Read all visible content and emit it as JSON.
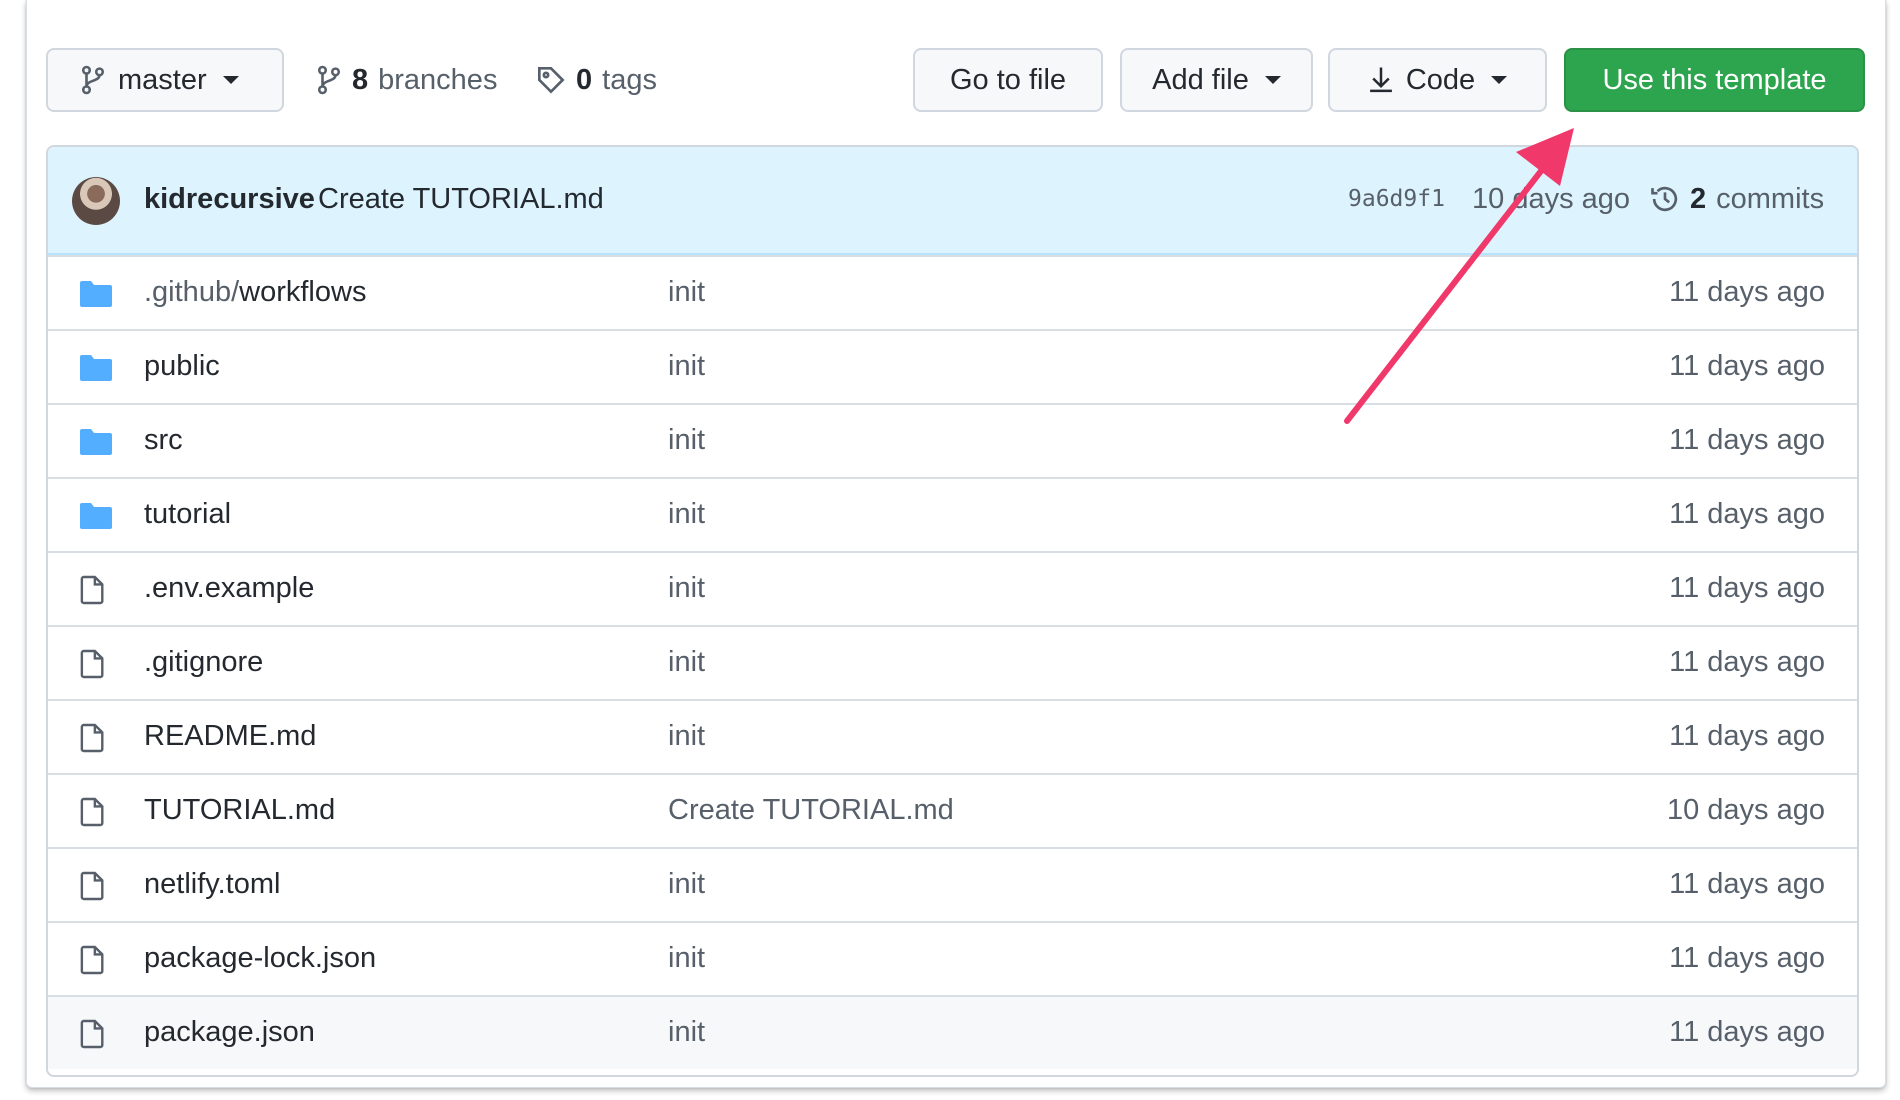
{
  "toolbar": {
    "branch_label": "master",
    "branches_count": "8",
    "branches_label": "branches",
    "tags_count": "0",
    "tags_label": "tags",
    "go_to_file_label": "Go to file",
    "add_file_label": "Add file",
    "code_label": "Code",
    "template_label": "Use this template"
  },
  "commit": {
    "author": "kidrecursive",
    "message": "Create TUTORIAL.md",
    "sha": "9a6d9f1",
    "time": "10 days ago",
    "count": "2",
    "count_label": "commits"
  },
  "files": [
    {
      "type": "folder",
      "prefix": ".github/",
      "name": "workflows",
      "message": "init",
      "time": "11 days ago"
    },
    {
      "type": "folder",
      "prefix": "",
      "name": "public",
      "message": "init",
      "time": "11 days ago"
    },
    {
      "type": "folder",
      "prefix": "",
      "name": "src",
      "message": "init",
      "time": "11 days ago"
    },
    {
      "type": "folder",
      "prefix": "",
      "name": "tutorial",
      "message": "init",
      "time": "11 days ago"
    },
    {
      "type": "file",
      "prefix": "",
      "name": ".env.example",
      "message": "init",
      "time": "11 days ago"
    },
    {
      "type": "file",
      "prefix": "",
      "name": ".gitignore",
      "message": "init",
      "time": "11 days ago"
    },
    {
      "type": "file",
      "prefix": "",
      "name": "README.md",
      "message": "init",
      "time": "11 days ago"
    },
    {
      "type": "file",
      "prefix": "",
      "name": "TUTORIAL.md",
      "message": "Create TUTORIAL.md",
      "time": "10 days ago"
    },
    {
      "type": "file",
      "prefix": "",
      "name": "netlify.toml",
      "message": "init",
      "time": "11 days ago"
    },
    {
      "type": "file",
      "prefix": "",
      "name": "package-lock.json",
      "message": "init",
      "time": "11 days ago"
    },
    {
      "type": "file",
      "prefix": "",
      "name": "package.json",
      "message": "init",
      "time": "11 days ago"
    }
  ],
  "colors": {
    "template_button": "#2da44e",
    "commit_bar": "#ddf4ff",
    "folder_icon": "#54aeff",
    "annotation_arrow": "#f0386b"
  },
  "icons": {
    "branch": "git-branch-icon",
    "tag": "tag-icon",
    "download": "download-icon",
    "history": "history-icon",
    "folder": "folder-icon",
    "file": "file-icon"
  }
}
